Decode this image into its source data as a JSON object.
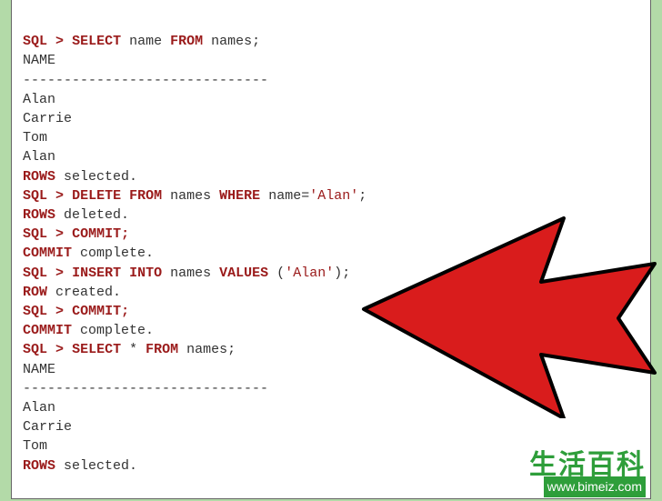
{
  "sql": {
    "kw_sql": "SQL",
    "gt": ">",
    "kw_select": "SELECT",
    "kw_from": "FROM",
    "kw_delete": "DELETE",
    "kw_where": "WHERE",
    "kw_commit_cmd": "COMMIT;",
    "kw_insert": "INSERT",
    "kw_into": "INTO",
    "kw_values": "VALUES",
    "kw_rows": "ROWS",
    "kw_row": "ROW",
    "kw_commit": "COMMIT",
    "id_name": "name",
    "id_names": "names",
    "str_alan": "'Alan'",
    "star": "*",
    "hdr_name": "NAME",
    "rule": "------------------------------",
    "val_alan": "Alan",
    "val_carrie": "Carrie",
    "val_tom": "Tom",
    "txt_selected": "selected.",
    "txt_deleted": "deleted.",
    "txt_complete": "complete.",
    "txt_created": "created.",
    "q1_suffix": " FROM names;",
    "semicolon": ";"
  },
  "watermark": {
    "title": "生活百科",
    "url": "www.bimeiz.com"
  }
}
